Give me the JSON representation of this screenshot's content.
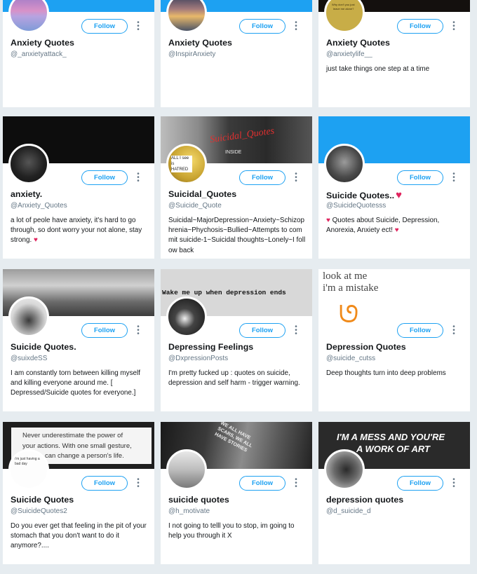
{
  "follow_label": "Follow",
  "colors": {
    "accent": "#1da1f2",
    "background": "#e6ecf0",
    "muted": "#657786",
    "heart": "#e0245e"
  },
  "cards": [
    {
      "name": "Anxiety Quotes",
      "handle": "@_anxietyattack_",
      "bio": ""
    },
    {
      "name": "Anxiety Quotes",
      "handle": "@InspirAnxiety",
      "bio": ""
    },
    {
      "name": "Anxiety Quotes",
      "handle": "@anxietylife__",
      "bio": "just take things one step at a time"
    },
    {
      "name": "anxiety.",
      "handle": "@Anxiety_Quotes",
      "bio": "a lot of peole have anxiety, it's hard to go through, so dont worry your not alone, stay strong."
    },
    {
      "name": "Suicidal_Quotes",
      "handle": "@Suicide_Quote",
      "bio": "Suicidal~MajorDepression~Anxiety~Schizophrenia~Phychosis~Bullied~Attempts to commit suicide-1~Suicidal thoughts~Lonely~I follow back"
    },
    {
      "name": "Suicide Quotes..",
      "handle": "@SuicideQuotesss",
      "bio": "Quotes about Suicide, Depression, Anorexia, Anxiety ect!"
    },
    {
      "name": "Suicide Quotes.",
      "handle": "@suixdeSS",
      "bio": "I am constantly torn between killing myself and killing everyone around me. [ Depressed/Suicide quotes for everyone.]"
    },
    {
      "name": "Depressing Feelings",
      "handle": "@DxpressionPosts",
      "bio": "I'm pretty fucked up : quotes on suicide, depression and self harm - trigger warning."
    },
    {
      "name": "Depression Quotes",
      "handle": "@suicide_cutss",
      "bio": "Deep thoughts turn into deep problems"
    },
    {
      "name": "Suicide Quotes",
      "handle": "@SuicideQuotes2",
      "bio": "Do you ever get that feeling in the pit of your stomach that you don't want to do it anymore?...."
    },
    {
      "name": "suicide quotes",
      "handle": "@h_motivate",
      "bio": "I not going to telll you to stop, im going to help you through it X"
    },
    {
      "name": "depression quotes",
      "handle": "@d_suicide_d",
      "bio": ""
    }
  ],
  "banner_texts": {
    "b5": "Suicidal_Quotes",
    "b5b": "INSIDE",
    "b8": "Wake me up when depression ends",
    "b9a": "look at me",
    "b9b": "i'm a mistake",
    "b10a": "Never underestimate the power of",
    "b10b": "your actions. With one small gesture,",
    "b10c": "can change a person's life.",
    "b11": "WE ALL HAVE SCARS, WE ALL HAVE STORIES",
    "b12a": "I'M A MESS AND YOU'RE",
    "b12b": "A WORK OF ART"
  },
  "avatar_texts": {
    "a3a": "Why don't you just",
    "a3b": "leave me alone?",
    "a5": "ALL I see is HATRED",
    "a10": "i'm just having a bad day"
  }
}
